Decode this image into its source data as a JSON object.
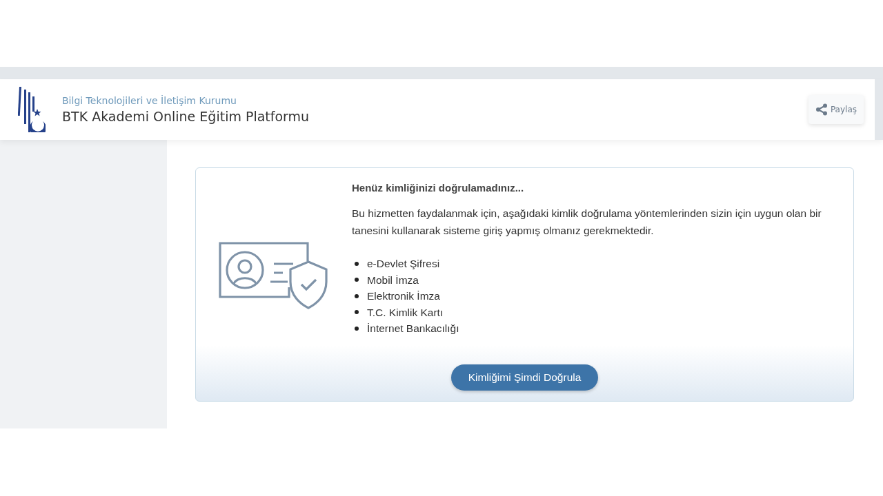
{
  "header": {
    "subtitle": "Bilgi Teknolojileri ve İletişim Kurumu",
    "title": "BTK Akademi Online Eğitim Platformu",
    "share_button": "Paylaş"
  },
  "notice": {
    "heading": "Henüz kimliğinizi doğrulamadınız...",
    "text": "Bu hizmetten faydalanmak için, aşağıdaki kimlik doğrulama yöntemlerinden sizin için uygun olan bir tanesini kullanarak sisteme giriş yapmış olmanız gerekmektedir.",
    "methods": [
      "e-Devlet Şifresi",
      "Mobil İmza",
      "Elektronik İmza",
      "T.C. Kimlik Kartı",
      "İnternet Bankacılığı"
    ],
    "button": "Kimliğimi Şimdi Doğrula"
  }
}
